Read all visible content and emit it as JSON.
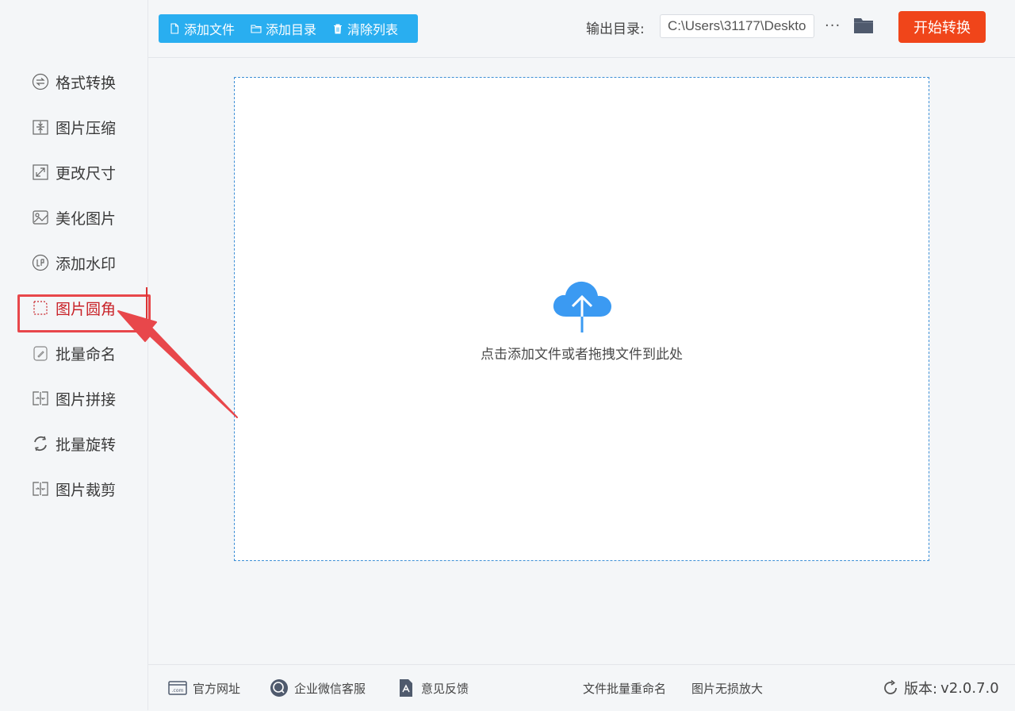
{
  "sidebar": {
    "items": [
      {
        "label": "格式转换",
        "icon": "format-convert-icon"
      },
      {
        "label": "图片压缩",
        "icon": "compress-icon"
      },
      {
        "label": "更改尺寸",
        "icon": "resize-icon"
      },
      {
        "label": "美化图片",
        "icon": "beautify-icon"
      },
      {
        "label": "添加水印",
        "icon": "watermark-icon"
      },
      {
        "label": "图片圆角",
        "icon": "round-corner-icon",
        "active": true
      },
      {
        "label": "批量命名",
        "icon": "rename-icon"
      },
      {
        "label": "图片拼接",
        "icon": "join-icon"
      },
      {
        "label": "批量旋转",
        "icon": "rotate-icon"
      },
      {
        "label": "图片裁剪",
        "icon": "crop-icon"
      }
    ]
  },
  "toolbar": {
    "add_file": "添加文件",
    "add_folder": "添加目录",
    "clear_list": "清除列表",
    "output_label": "输出目录:",
    "output_path": "C:\\Users\\31177\\Deskto",
    "more": "···",
    "start": "开始转换"
  },
  "dropzone": {
    "text": "点击添加文件或者拖拽文件到此处"
  },
  "footer": {
    "website": "官方网址",
    "wechat": "企业微信客服",
    "feedback": "意见反馈",
    "batch_rename": "文件批量重命名",
    "lossless_enlarge": "图片无损放大",
    "version_label": "版本:",
    "version": "v2.0.7.0"
  },
  "colors": {
    "primary_blue": "#29aef0",
    "start_orange": "#f0451a",
    "highlight_red": "#e8474b",
    "active_text": "#c82127",
    "cloud_blue": "#3b9af2"
  }
}
